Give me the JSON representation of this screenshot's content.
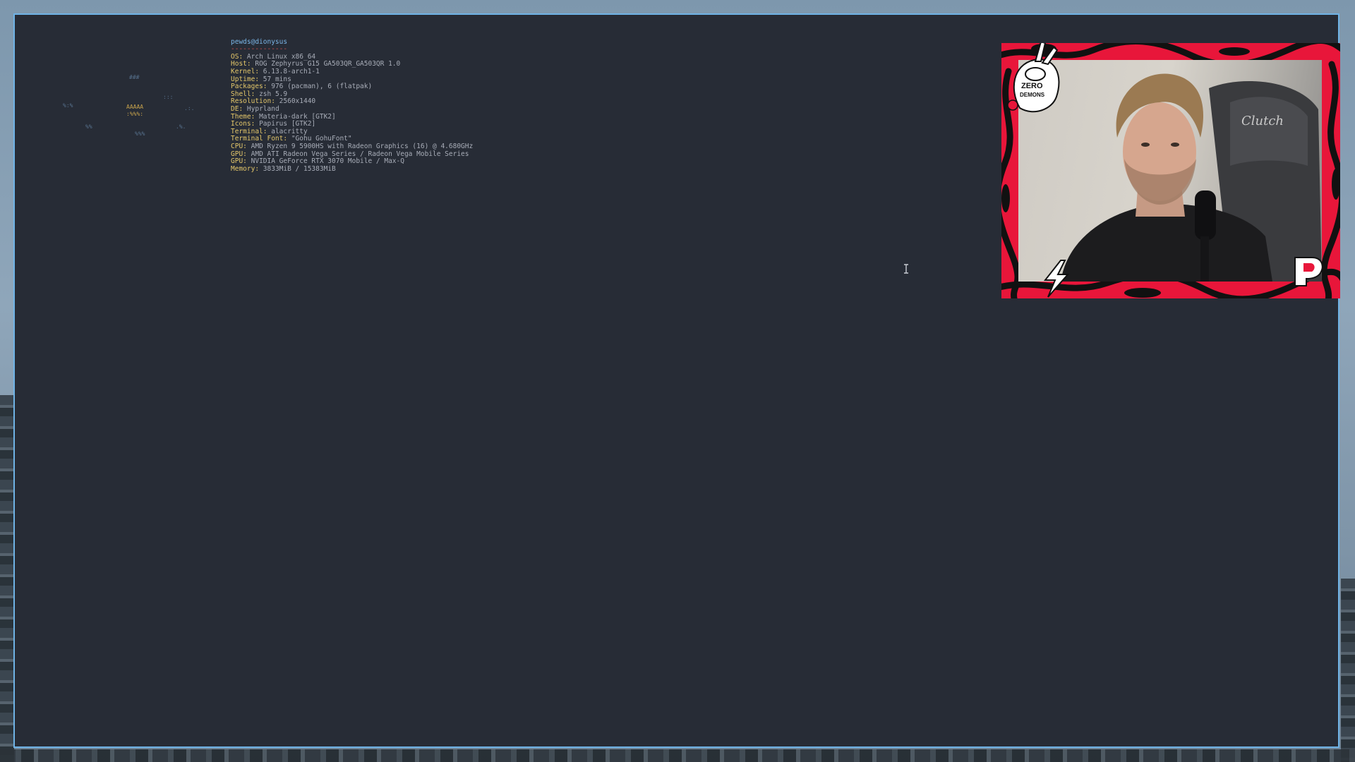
{
  "terminal": {
    "prompt": {
      "user_host": "pewds@dionysus",
      "separator": "--------------"
    },
    "info": [
      {
        "key": "OS",
        "value": "Arch Linux x86_64"
      },
      {
        "key": "Host",
        "value": "ROG Zephyrus G15 GA503QR_GA503QR 1.0"
      },
      {
        "key": "Kernel",
        "value": "6.13.8-arch1-1"
      },
      {
        "key": "Uptime",
        "value": "57 mins"
      },
      {
        "key": "Packages",
        "value": "976 (pacman), 6 (flatpak)"
      },
      {
        "key": "Shell",
        "value": "zsh 5.9"
      },
      {
        "key": "Resolution",
        "value": "2560x1440"
      },
      {
        "key": "DE",
        "value": "Hyprland"
      },
      {
        "key": "Theme",
        "value": "Materia-dark [GTK2]"
      },
      {
        "key": "Icons",
        "value": "Papirus [GTK2]"
      },
      {
        "key": "Terminal",
        "value": "alacritty"
      },
      {
        "key": "Terminal Font",
        "value": "\"Gohu GohuFont\""
      },
      {
        "key": "CPU",
        "value": "AMD Ryzen 9 5900HS with Radeon Graphics (16) @ 4.680GHz"
      },
      {
        "key": "GPU",
        "value": "AMD ATI Radeon Vega Series / Radeon Vega Mobile Series"
      },
      {
        "key": "GPU",
        "value": "NVIDIA GeForce RTX 3070 Mobile / Max-Q"
      },
      {
        "key": "Memory",
        "value": "3833MiB / 15383MiB"
      }
    ],
    "logo_marks": [
      {
        "text": "###",
        "accent": false
      },
      {
        "text": ":::",
        "accent": false
      },
      {
        "text": "%:%",
        "accent": false
      },
      {
        "text": "AAAAA",
        "accent": true
      },
      {
        "text": ":%%%:",
        "accent": true
      },
      {
        "text": ".:.",
        "accent": false
      },
      {
        "text": "%%",
        "accent": false
      },
      {
        "text": "%%%",
        "accent": false
      },
      {
        "text": ".%.",
        "accent": false
      }
    ]
  },
  "webcam": {
    "sticker_text": [
      "ZERO",
      "DEMONS"
    ],
    "chair_brand": "Clutch"
  },
  "colors": {
    "terminal_bg": "#272c36",
    "border": "#6fb3e6",
    "key": "#e4c76a",
    "user_host": "#7ab6e8",
    "overlay_red": "#e8163a"
  }
}
